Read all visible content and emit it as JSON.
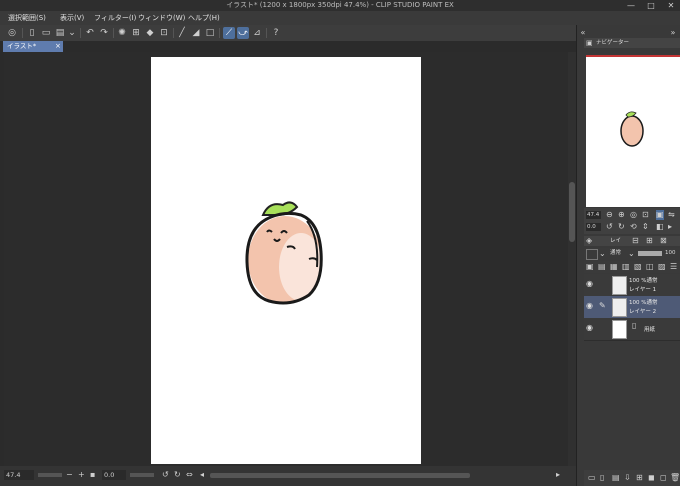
{
  "window": {
    "title": "イラスト* (1200 x 1800px 350dpi 47.4%)  - CLIP STUDIO PAINT EX",
    "minimize": "—",
    "maximize": "□",
    "close": "✕"
  },
  "menubar": {
    "items": [
      "選択範囲(S)",
      "表示(V)",
      "フィルター(I)",
      "ウィンドウ(W)",
      "ヘルプ(H)"
    ]
  },
  "tab": {
    "label": "イラスト*",
    "close": "×"
  },
  "status": {
    "zoom": "47.4",
    "angle": "0.0"
  },
  "navigator": {
    "title": "ナビゲーター",
    "zoom": "47.4",
    "angle": "0.0"
  },
  "layers": {
    "panel_label": "レイ",
    "blend_mode": "通常",
    "opacity": "100",
    "items": [
      {
        "line1": "100 %通常",
        "line2": "レイヤー 1",
        "selected": false
      },
      {
        "line1": "100 %通常",
        "line2": "レイヤー 2",
        "selected": true
      },
      {
        "line1": "",
        "line2": "用紙",
        "selected": false
      }
    ]
  },
  "colors": {
    "accent": "#5f7cae",
    "selected_layer": "#4e5a76",
    "paper": "#ffffff",
    "nav_border": "#c43535"
  }
}
